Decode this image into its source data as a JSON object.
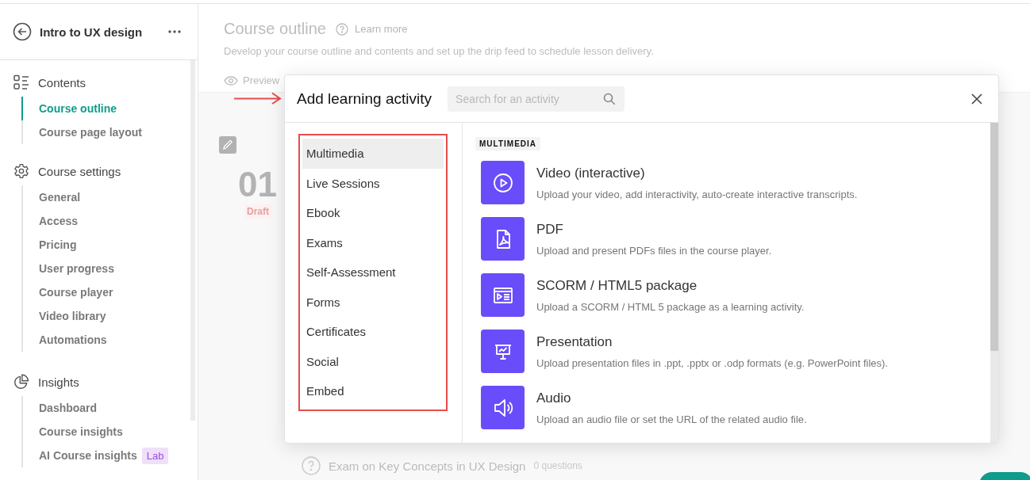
{
  "sidebar": {
    "course_title": "Intro to UX design",
    "sections": [
      {
        "title": "Contents",
        "items": [
          {
            "label": "Course outline",
            "selected": true
          },
          {
            "label": "Course page layout",
            "selected": false
          }
        ]
      },
      {
        "title": "Course settings",
        "items": [
          {
            "label": "General",
            "selected": false
          },
          {
            "label": "Access",
            "selected": false
          },
          {
            "label": "Pricing",
            "selected": false
          },
          {
            "label": "User progress",
            "selected": false
          },
          {
            "label": "Course player",
            "selected": false
          },
          {
            "label": "Video library",
            "selected": false
          },
          {
            "label": "Automations",
            "selected": false
          }
        ]
      },
      {
        "title": "Insights",
        "items": [
          {
            "label": "Dashboard",
            "selected": false
          },
          {
            "label": "Course insights",
            "selected": false
          },
          {
            "label": "AI Course insights",
            "selected": false,
            "badge": "Lab"
          }
        ]
      }
    ]
  },
  "main": {
    "title": "Course outline",
    "help_link": "Learn more",
    "description": "Develop your course outline and contents and set up the drip feed to schedule lesson delivery.",
    "preview": "Preview",
    "section_number": "01",
    "section_status": "Draft",
    "lessons": [
      {
        "title": "Exam on Key Concepts in UX Design",
        "meta": "0 questions"
      }
    ]
  },
  "modal": {
    "title": "Add learning activity",
    "search": {
      "placeholder": "Search for an activity"
    },
    "categories": [
      {
        "label": "Multimedia",
        "selected": true
      },
      {
        "label": "Live Sessions",
        "selected": false
      },
      {
        "label": "Ebook",
        "selected": false
      },
      {
        "label": "Exams",
        "selected": false
      },
      {
        "label": "Self-Assessment",
        "selected": false
      },
      {
        "label": "Forms",
        "selected": false
      },
      {
        "label": "Certificates",
        "selected": false
      },
      {
        "label": "Social",
        "selected": false
      },
      {
        "label": "Embed",
        "selected": false
      }
    ],
    "section_label": "MULTIMEDIA",
    "activities": [
      {
        "title": "Video (interactive)",
        "description": "Upload your video, add interactivity, auto-create interactive transcripts."
      },
      {
        "title": "PDF",
        "description": "Upload and present PDFs files in the course player."
      },
      {
        "title": "SCORM / HTML5 package",
        "description": "Upload a SCORM / HTML 5 package as a learning activity."
      },
      {
        "title": "Presentation",
        "description": "Upload presentation files in .ppt, .pptx or .odp formats (e.g. PowerPoint files)."
      },
      {
        "title": "Audio",
        "description": "Upload an audio file or set the URL of the related audio file."
      }
    ]
  }
}
